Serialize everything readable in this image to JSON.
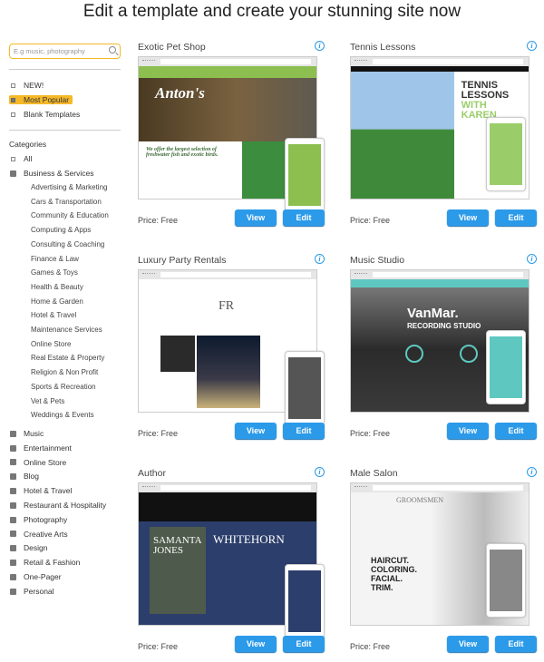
{
  "header": {
    "title": "Edit a template and create your stunning site now"
  },
  "sidebar": {
    "search_placeholder": "E.g music, photography",
    "filters": [
      {
        "label": "NEW!",
        "selected": false
      },
      {
        "label": "Most Popular",
        "selected": true
      },
      {
        "label": "Blank Templates",
        "selected": false
      }
    ],
    "categories_heading": "Categories",
    "all_label": "All",
    "expanded": {
      "label": "Business & Services",
      "items": [
        "Advertising & Marketing",
        "Cars & Transportation",
        "Community & Education",
        "Computing & Apps",
        "Consulting & Coaching",
        "Finance & Law",
        "Games & Toys",
        "Health & Beauty",
        "Home & Garden",
        "Hotel & Travel",
        "Maintenance Services",
        "Online Store",
        "Real Estate & Property",
        "Religion & Non Profit",
        "Sports & Recreation",
        "Vet & Pets",
        "Weddings & Events"
      ]
    },
    "collapsed": [
      "Music",
      "Entertainment",
      "Online Store",
      "Blog",
      "Hotel & Travel",
      "Restaurant & Hospitality",
      "Photography",
      "Creative Arts",
      "Design",
      "Retail & Fashion",
      "One-Pager",
      "Personal"
    ]
  },
  "templates": [
    {
      "name": "Exotic Pet Shop",
      "price": "Price: Free",
      "view": "View",
      "edit": "Edit",
      "brand": "Anton's",
      "tagline": "We offer the largest selection of freshwater fish and exotic birds.",
      "accent": "#8cbf4f"
    },
    {
      "name": "Tennis Lessons",
      "price": "Price: Free",
      "view": "View",
      "edit": "Edit",
      "brand": "TENNIS LESSONS",
      "tagline": "WITH KAREN",
      "accent": "#9acd6a"
    },
    {
      "name": "Luxury Party Rentals",
      "price": "Price: Free",
      "view": "View",
      "edit": "Edit",
      "brand": "FR",
      "accent": "#555555"
    },
    {
      "name": "Music Studio",
      "price": "Price: Free",
      "view": "View",
      "edit": "Edit",
      "brand": "VanMar.",
      "tagline": "RECORDING STUDIO",
      "accent": "#5ec8c0"
    },
    {
      "name": "Author",
      "price": "Price: Free",
      "view": "View",
      "edit": "Edit",
      "brand": "SAMANTA JONES",
      "tagline": "WHITEHORN",
      "accent": "#2c3e6b"
    },
    {
      "name": "Male Salon",
      "price": "Price: Free",
      "view": "View",
      "edit": "Edit",
      "brand": "GROOMSMEN",
      "tagline": "HAIRCUT. COLORING. FACIAL. TRIM.",
      "accent": "#888888"
    }
  ],
  "colors": {
    "primary_button": "#2b9ae9",
    "highlight": "#f5b829"
  }
}
